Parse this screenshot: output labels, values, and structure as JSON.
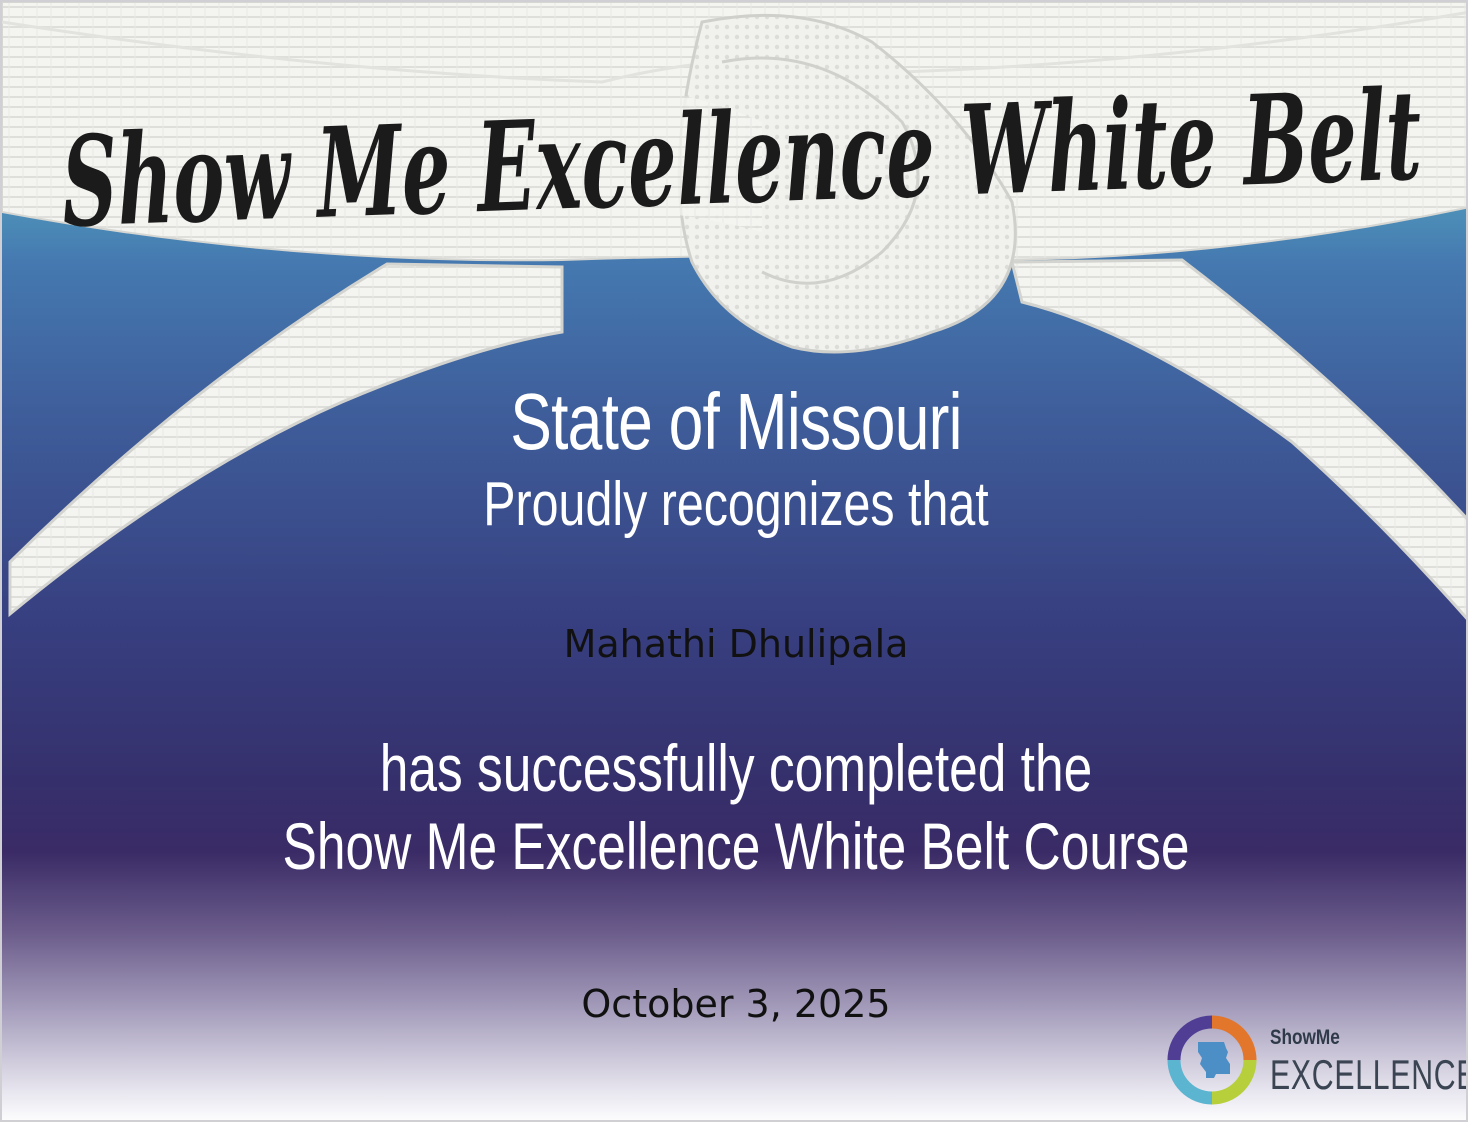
{
  "certificate": {
    "title": "Show Me Excellence White Belt",
    "issuer": "State of Missouri",
    "recognizes": "Proudly recognizes that",
    "recipient": "Mahathi Dhulipala",
    "completed_line": "has successfully completed the",
    "course": "Show Me Excellence White Belt Course",
    "date": "October 3, 2025"
  },
  "logo": {
    "top_text": "ShowMe",
    "bottom_text": "EXCELLENCE",
    "ring_colors": [
      "#e2762b",
      "#b6cf3a",
      "#5bb4d0",
      "#4f3e94"
    ],
    "state_color": "#4c8fc6"
  },
  "colors": {
    "belt": "#f4f4f1",
    "belt_shadow": "#d9d9d5",
    "title_ink": "#1b1b1b",
    "gradient_top": "#62c0c9",
    "gradient_mid": "#35306c",
    "gradient_bottom": "#ffffff"
  },
  "icons": {
    "logo_mark": "missouri-state-ring-icon"
  }
}
